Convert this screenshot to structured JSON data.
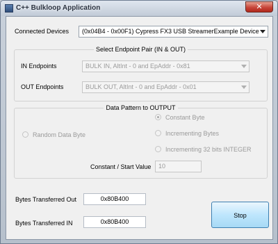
{
  "window": {
    "title": "C++ Bulkloop Application",
    "close_glyph": "✕"
  },
  "connected_devices": {
    "label": "Connected Devices",
    "selected": "(0x04B4 - 0x00F1) Cypress FX3 USB StreamerExample Device"
  },
  "endpoint_group": {
    "title": "Select Endpoint Pair (IN & OUT)",
    "in_label": "IN Endpoints",
    "in_selected": "BULK IN, AltInt - 0 and EpAddr - 0x81",
    "out_label": "OUT Endpoints",
    "out_selected": "BULK OUT, AltInt - 0 and EpAddr - 0x01"
  },
  "pattern_group": {
    "title": "Data Pattern to OUTPUT",
    "options": {
      "random": "Random Data Byte",
      "constant": "Constant Byte",
      "incrementing": "Incrementing Bytes",
      "incrementing32": "Incrementing 32 bits INTEGER"
    },
    "selected_option": "Constant Byte",
    "start_value_label": "Constant / Start Value",
    "start_value": "10"
  },
  "stats": {
    "out_label": "Bytes Transferred Out",
    "out_value": "0x80B400",
    "in_label": "Bytes Transferred IN",
    "in_value": "0x80B400"
  },
  "actions": {
    "stop_label": "Stop"
  }
}
